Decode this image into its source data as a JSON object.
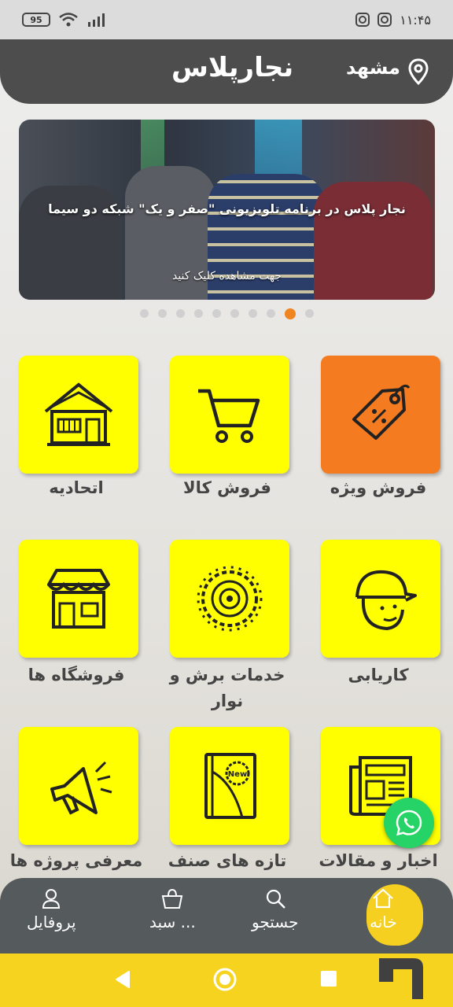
{
  "status_bar": {
    "time": "۱۱:۴۵",
    "battery": "95"
  },
  "header": {
    "title": "نجارپلاس",
    "city": "مشهد"
  },
  "banner": {
    "title": "نجار پلاس در برنامه تلویزیونی \"صفر و یک\" شبکه دو سیما",
    "subtitle": "جهت مشاهده کلیک کنید",
    "dots": 10,
    "active_dot": 9
  },
  "grid": {
    "items": [
      {
        "label": "فروش ویژه",
        "icon": "price-tag-icon",
        "color": "#f47b20"
      },
      {
        "label": "فروش کالا",
        "icon": "shopping-cart-icon",
        "color": "#ffff00"
      },
      {
        "label": "اتحادیه",
        "icon": "house-icon",
        "color": "#ffff00"
      },
      {
        "label": "کاریابی",
        "icon": "worker-helmet-icon",
        "color": "#ffff00"
      },
      {
        "label": "خدمات برش و نوار",
        "icon": "saw-blade-icon",
        "color": "#ffff00"
      },
      {
        "label": "فروشگاه ها",
        "icon": "store-icon",
        "color": "#ffff00"
      },
      {
        "label": "اخبار و مقالات",
        "icon": "newspaper-icon",
        "color": "#ffff00"
      },
      {
        "label": "تازه های صنف",
        "icon": "new-book-icon",
        "color": "#ffff00"
      },
      {
        "label": "معرفی پروژه ها",
        "icon": "megaphone-icon",
        "color": "#ffff00"
      }
    ],
    "new_badge": "New"
  },
  "bottom_nav": {
    "home": "خانه",
    "search": "جستجو",
    "cart": "سبد ...",
    "profile": "پروفایل"
  },
  "colors": {
    "accent_yellow": "#ffff00",
    "accent_orange": "#f47b20",
    "header": "#4d4d4d",
    "whatsapp": "#25d366"
  }
}
